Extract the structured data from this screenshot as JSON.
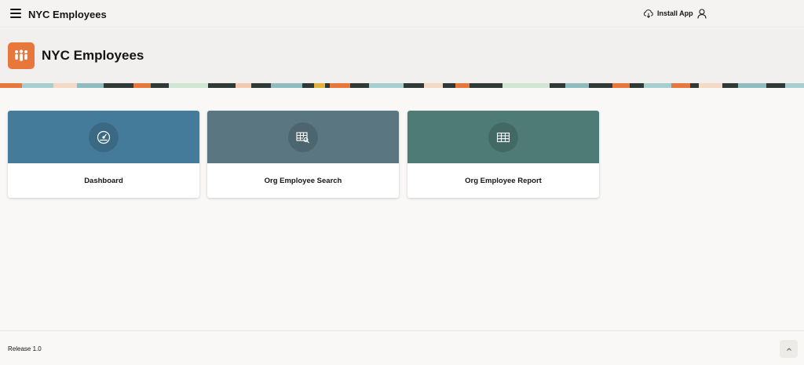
{
  "header": {
    "app_title": "NYC Employees",
    "install_label": "Install App",
    "menu_icon": "hamburger-menu-icon",
    "install_icon": "cloud-download-icon",
    "user_icon": "user-icon"
  },
  "hero": {
    "title": "NYC Employees",
    "icon": "people-icon",
    "icon_color": "#e8773c"
  },
  "cards": [
    {
      "label": "Dashboard",
      "icon": "gauge-icon",
      "color": "#457b9a"
    },
    {
      "label": "Org Employee Search",
      "icon": "table-search-icon",
      "color": "#5a7681"
    },
    {
      "label": "Org Employee Report",
      "icon": "table-icon",
      "color": "#4e7b76"
    }
  ],
  "footer": {
    "release": "Release 1.0",
    "scroll_top_icon": "chevron-up-icon"
  }
}
